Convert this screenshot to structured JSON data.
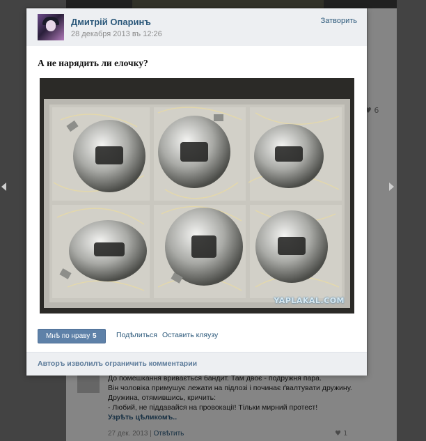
{
  "post": {
    "author": "Дмитрій Опаринъ",
    "date": "28 декабря 2013 въ 12:26",
    "close_label": "Затворить",
    "text": "А не нарядить ли елочку?",
    "watermark": "YAPLAKAL.COM",
    "like_label": "Мнѣ по нраву",
    "like_count": "5",
    "share_label": "Подѣлиться",
    "complain_label": "Оставить кляузу",
    "comments_disabled": "Авторъ изволилъ ограничить комментарии"
  },
  "background": {
    "like_top_count": "6",
    "comment_lines": [
      "До помешкання вривається бандит. Там двоє - подружня пара.",
      "Він чоловіка примушує лежати на підлозі і починає ґвалтувати дружину.",
      "Дружина, отямившись, кричить:",
      "- Любий, не піддавайся на провокації! Тільки мирний протест!"
    ],
    "read_more": "Узрѣть цѣликомъ..",
    "comment_date": "27 дек. 2013",
    "reply_label": "Отвѣтить",
    "comment_likes": "1"
  },
  "colors": {
    "link": "#2b587a",
    "like_button": "#5e81a8",
    "header_bg": "#edeff2"
  },
  "icons": [
    "heart-icon",
    "nav-left-arrow-icon",
    "nav-right-arrow-icon"
  ]
}
